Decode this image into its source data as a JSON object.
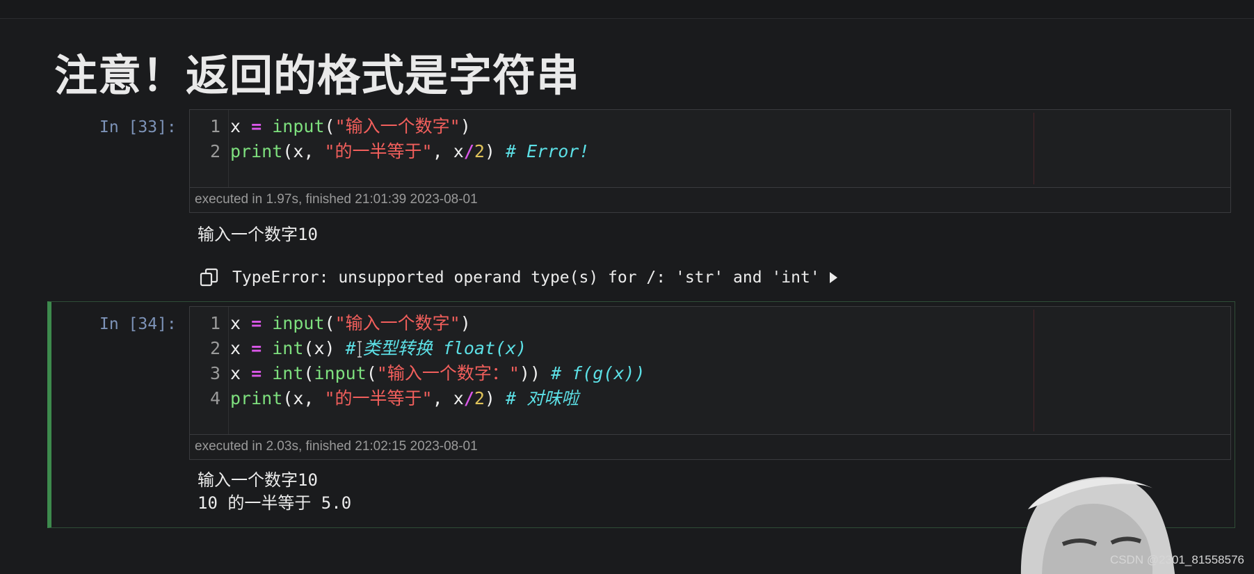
{
  "title": "注意！返回的格式是字符串",
  "cells": [
    {
      "prompt": "In [33]:",
      "code_lines": [
        {
          "n": "1",
          "parts": [
            {
              "t": "x",
              "c": "var"
            },
            {
              "t": " ",
              "c": "pun"
            },
            {
              "t": "=",
              "c": "op"
            },
            {
              "t": " ",
              "c": "pun"
            },
            {
              "t": "input",
              "c": "fn"
            },
            {
              "t": "(",
              "c": "pun"
            },
            {
              "t": "\"输入一个数字\"",
              "c": "str"
            },
            {
              "t": ")",
              "c": "pun"
            }
          ]
        },
        {
          "n": "2",
          "parts": [
            {
              "t": "print",
              "c": "fn"
            },
            {
              "t": "(x, ",
              "c": "pun"
            },
            {
              "t": "\"的一半等于\"",
              "c": "str"
            },
            {
              "t": ", x",
              "c": "pun"
            },
            {
              "t": "/",
              "c": "op"
            },
            {
              "t": "2",
              "c": "num"
            },
            {
              "t": ") ",
              "c": "pun"
            },
            {
              "t": "# Error!",
              "c": "cmt"
            }
          ]
        }
      ],
      "exec_info": "executed in 1.97s, finished 21:01:39 2023-08-01",
      "output_lines": [
        "输入一个数字10"
      ],
      "error": "TypeError: unsupported operand type(s) for /: 'str' and 'int'"
    },
    {
      "prompt": "In [34]:",
      "code_lines": [
        {
          "n": "1",
          "parts": [
            {
              "t": "x",
              "c": "var"
            },
            {
              "t": " ",
              "c": "pun"
            },
            {
              "t": "=",
              "c": "op"
            },
            {
              "t": " ",
              "c": "pun"
            },
            {
              "t": "input",
              "c": "fn"
            },
            {
              "t": "(",
              "c": "pun"
            },
            {
              "t": "\"输入一个数字\"",
              "c": "str"
            },
            {
              "t": ")",
              "c": "pun"
            }
          ]
        },
        {
          "n": "2",
          "parts": [
            {
              "t": "x",
              "c": "var"
            },
            {
              "t": " ",
              "c": "pun"
            },
            {
              "t": "=",
              "c": "op"
            },
            {
              "t": " ",
              "c": "pun"
            },
            {
              "t": "int",
              "c": "fn"
            },
            {
              "t": "(x) ",
              "c": "pun"
            },
            {
              "t": "#",
              "c": "cmt"
            },
            {
              "t": "",
              "c": "cursor"
            },
            {
              "t": "类型转换 float(x)",
              "c": "cmt"
            }
          ]
        },
        {
          "n": "3",
          "parts": [
            {
              "t": "x",
              "c": "var"
            },
            {
              "t": " ",
              "c": "pun"
            },
            {
              "t": "=",
              "c": "op"
            },
            {
              "t": " ",
              "c": "pun"
            },
            {
              "t": "int",
              "c": "fn"
            },
            {
              "t": "(",
              "c": "pun"
            },
            {
              "t": "input",
              "c": "fn"
            },
            {
              "t": "(",
              "c": "pun"
            },
            {
              "t": "\"输入一个数字：\"",
              "c": "str"
            },
            {
              "t": ")) ",
              "c": "pun"
            },
            {
              "t": "# f(g(x))",
              "c": "cmt"
            }
          ]
        },
        {
          "n": "4",
          "parts": [
            {
              "t": "print",
              "c": "fn"
            },
            {
              "t": "(x, ",
              "c": "pun"
            },
            {
              "t": "\"的一半等于\"",
              "c": "str"
            },
            {
              "t": ", x",
              "c": "pun"
            },
            {
              "t": "/",
              "c": "op"
            },
            {
              "t": "2",
              "c": "num"
            },
            {
              "t": ") ",
              "c": "pun"
            },
            {
              "t": "# 对味啦",
              "c": "cmt"
            }
          ]
        }
      ],
      "exec_info": "executed in 2.03s, finished 21:02:15 2023-08-01",
      "output_lines": [
        "输入一个数字10",
        "10 的一半等于 5.0"
      ]
    }
  ],
  "icons": {
    "copy": "copy-icon",
    "expand": "expand-arrow-icon",
    "cursor": "text-cursor-icon"
  },
  "watermark": "CSDN @2301_81558576"
}
